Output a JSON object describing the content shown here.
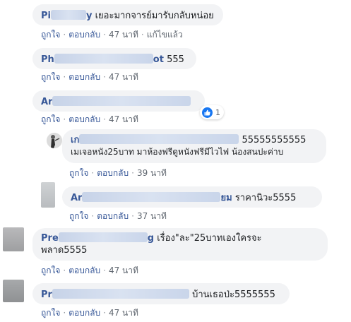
{
  "actions": {
    "like_label": "ถูกใจ",
    "reply_label": "ตอบกลับ",
    "separator": "·"
  },
  "comments": [
    {
      "name_start": "Pi",
      "name_end": "y",
      "text": "เยอะมากจารย์มารับกลับหน่อย",
      "time": "47 นาที",
      "edited": "แก้ไขแล้ว"
    },
    {
      "name_start": "Ph",
      "name_end": "ot",
      "text": "555",
      "time": "47 นาที"
    },
    {
      "name_start": "Ar",
      "text": "",
      "time": "47 นาที",
      "reaction_count": "1"
    },
    {
      "name_start": "เก",
      "text": "55555555555",
      "text_line2": "เมเจอหนัง25บาท มาห้องฟรีดูหนังฟรีมีไวไฟ น้องสนปะค่าบ",
      "time": "39 นาที"
    },
    {
      "name_start": "Ar",
      "name_end": "ยม",
      "text": "ราคานิวะ5555",
      "time": "37 นาที"
    },
    {
      "name_start": "Pre",
      "name_end": "g",
      "text": "เรื่อง\"ละ\"25บาทเองใครจะ",
      "text_line2": "พลาด5555",
      "time": "47 นาที"
    },
    {
      "name_start": "Pr",
      "text": "บ้านเธอป่ะ5555555",
      "time": "47 นาที"
    }
  ]
}
